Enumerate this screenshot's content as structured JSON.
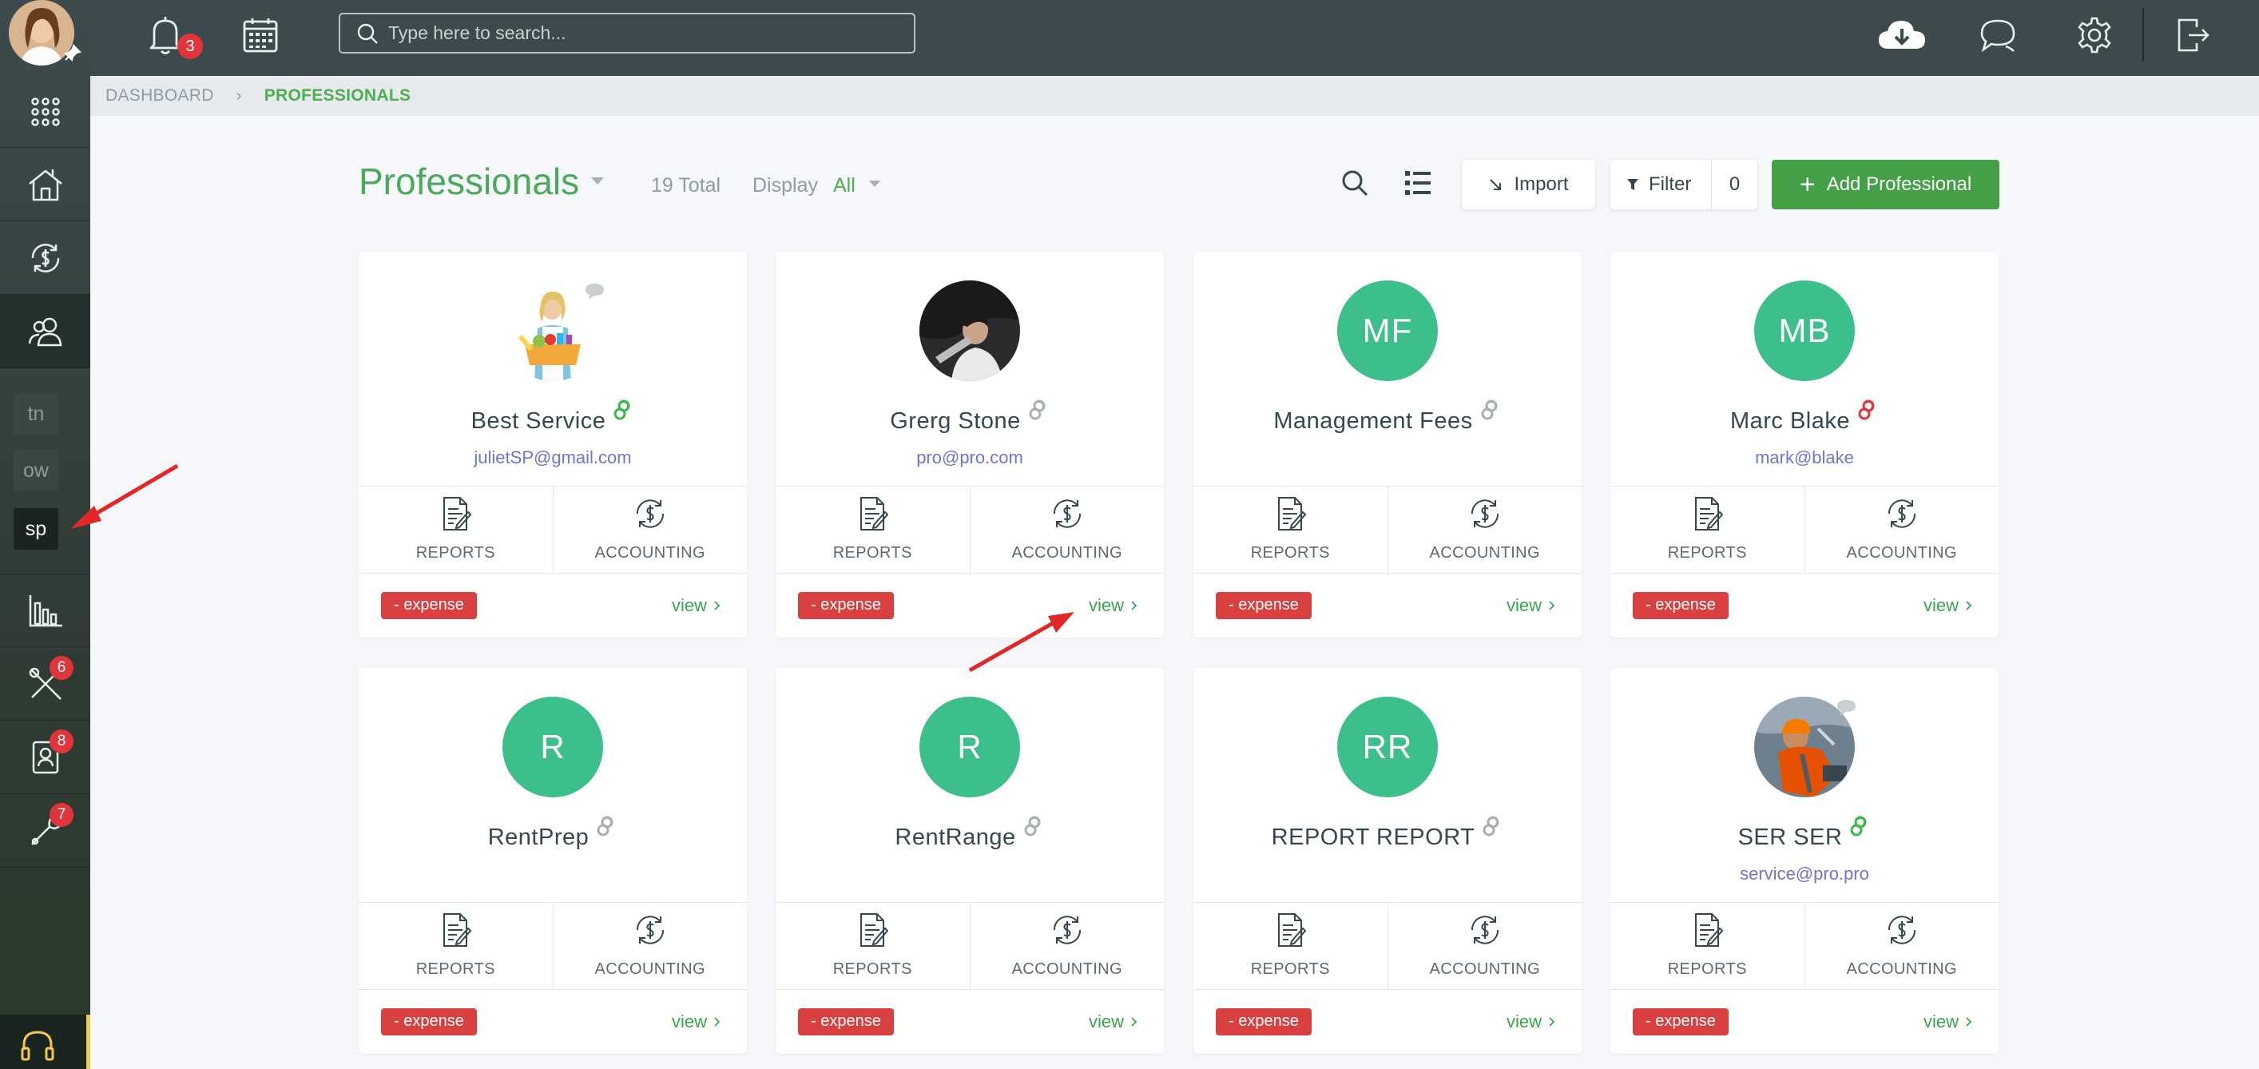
{
  "topbar": {
    "notifications_count": "3",
    "search_placeholder": "Type here to search..."
  },
  "sidebar": {
    "abbreviations": [
      "tn",
      "ow",
      "sp"
    ],
    "badges": {
      "tools": "6",
      "contacts": "8",
      "links": "7"
    }
  },
  "breadcrumb": {
    "root": "DASHBOARD",
    "current": "PROFESSIONALS"
  },
  "header": {
    "title": "Professionals",
    "total": "19 Total",
    "display_label": "Display",
    "display_value": "All",
    "import_label": "Import",
    "filter_label": "Filter",
    "filter_count": "0",
    "add_label": "Add Professional"
  },
  "card_labels": {
    "reports": "REPORTS",
    "accounting": "ACCOUNTING",
    "expense": "- expense",
    "view": "view"
  },
  "professionals": [
    {
      "name": "Best Service",
      "email": "julietSP@gmail.com",
      "initials": "",
      "avatar": "photo-cleaner",
      "linked": "green"
    },
    {
      "name": "Grerg Stone",
      "email": "pro@pro.com",
      "initials": "",
      "avatar": "photo-dark",
      "linked": "gray"
    },
    {
      "name": "Management Fees",
      "email": "",
      "initials": "MF",
      "avatar": "initials",
      "linked": "gray"
    },
    {
      "name": "Marc Blake",
      "email": "mark@blake",
      "initials": "MB",
      "avatar": "initials",
      "linked": "red"
    },
    {
      "name": "RentPrep",
      "email": "",
      "initials": "R",
      "avatar": "initials",
      "linked": "gray"
    },
    {
      "name": "RentRange",
      "email": "",
      "initials": "R",
      "avatar": "initials",
      "linked": "gray"
    },
    {
      "name": "REPORT REPORT",
      "email": "",
      "initials": "RR",
      "avatar": "initials",
      "linked": "gray"
    },
    {
      "name": "SER SER",
      "email": "service@pro.pro",
      "initials": "",
      "avatar": "photo-worker",
      "linked": "green"
    }
  ],
  "colors": {
    "accent_green": "#43a047",
    "avatar_teal": "#3dbf8c",
    "expense_red": "#d94040",
    "email_purple": "#6f74d6",
    "sidebar_dark": "#3d4a4d"
  }
}
